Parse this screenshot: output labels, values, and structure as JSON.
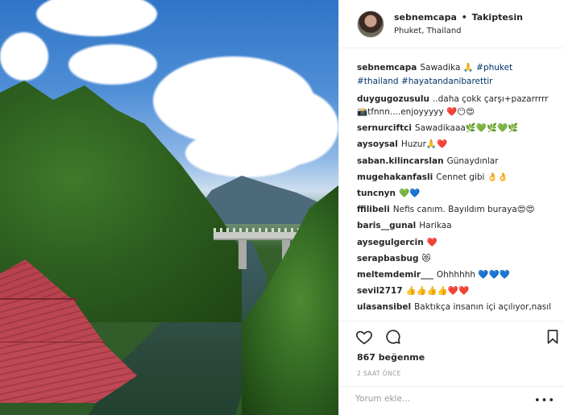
{
  "post": {
    "username": "sebnemcapa",
    "dot": "•",
    "follow_label": "Takiptesin",
    "location": "Phuket, Thailand"
  },
  "caption": {
    "username": "sebnemcapa",
    "text": "Sawadika 🙏",
    "hashtags": [
      "#phuket",
      "#thailand",
      "#hayatandanibarettir"
    ]
  },
  "comments": [
    {
      "user": "duygugozusulu",
      "text": "..daha çokk çarşı+pazarrrrr 📸tfnnn....enjoyyyyy ❤️😶😍"
    },
    {
      "user": "sernurciftci",
      "text": "Sawadikaaa🌿💚🌿💚🌿"
    },
    {
      "user": "aysoysal",
      "text": "Huzur🙏❤️"
    },
    {
      "user": "saban.kilincarslan",
      "text": "Günaydınlar"
    },
    {
      "user": "mugehakanfasli",
      "text": "Cennet gibi 👌👌"
    },
    {
      "user": "tuncnyn",
      "text": "💚💙"
    },
    {
      "user": "ffilibeli",
      "text": "Nefis canım. Bayıldım buraya😍😍"
    },
    {
      "user": "baris__gunal",
      "text": "Harikaa"
    },
    {
      "user": "aysegulgercin",
      "text": "❤️"
    },
    {
      "user": "serapbasbug",
      "text": "😻"
    },
    {
      "user": "meltemdemir___",
      "text": "Ohhhhhh 💙💙💙"
    },
    {
      "user": "sevil2717",
      "text": "👍👍👍👍❤️❤️"
    },
    {
      "user": "ulasansibel",
      "text": "Baktıkça insanın içi açılıyor,nasıl"
    }
  ],
  "actions": {
    "like_icon": "heart-icon",
    "comment_icon": "comment-icon",
    "save_icon": "bookmark-icon"
  },
  "likes": "867 beğenme",
  "time": "2 SAAT ÖNCE",
  "add_comment": {
    "placeholder": "Yorum ekle...",
    "more": "•••"
  },
  "colors": {
    "text": "#262626",
    "hashtag": "#003569",
    "muted": "#999999",
    "roof": "#b3414c"
  }
}
